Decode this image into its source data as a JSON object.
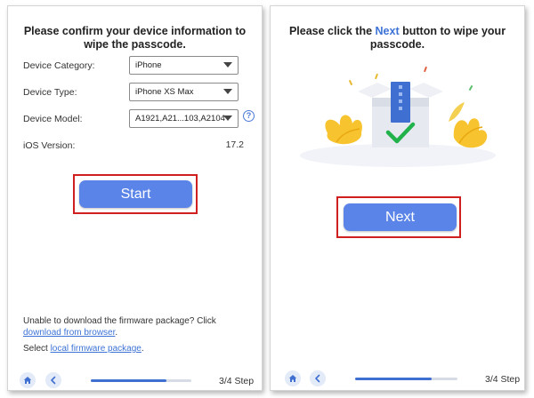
{
  "left": {
    "heading": "Please confirm your device information to wipe the passcode.",
    "fields": [
      {
        "label": "Device Category:",
        "value": "iPhone"
      },
      {
        "label": "Device Type:",
        "value": "iPhone XS Max"
      },
      {
        "label": "Device Model:",
        "value": "A1921,A21...103,A2104"
      }
    ],
    "ios_label": "iOS Version:",
    "ios_value": "17.2",
    "help_glyph": "?",
    "start_label": "Start",
    "firmware_note_prefix": "Unable to download the firmware package? Click ",
    "firmware_link": "download from browser",
    "firmware_note_suffix": ".",
    "local_prefix": "Select ",
    "local_link": "local firmware package",
    "local_suffix": ".",
    "step_label": "3/4 Step",
    "progress": 0.75
  },
  "right": {
    "heading_prefix": "Please click the ",
    "heading_accent": "Next",
    "heading_suffix": " button to wipe your passcode.",
    "next_label": "Next",
    "step_label": "3/4 Step",
    "progress": 0.75
  },
  "icons": {
    "home": "home-icon",
    "back": "chevron-left-icon",
    "help": "help-icon",
    "dropdown": "caret-down-icon",
    "illustration": "wipe-box-illustration"
  },
  "colors": {
    "accent": "#3d73d6",
    "button": "#5b84e8",
    "highlight": "#d11f1f",
    "check": "#22b24c"
  }
}
